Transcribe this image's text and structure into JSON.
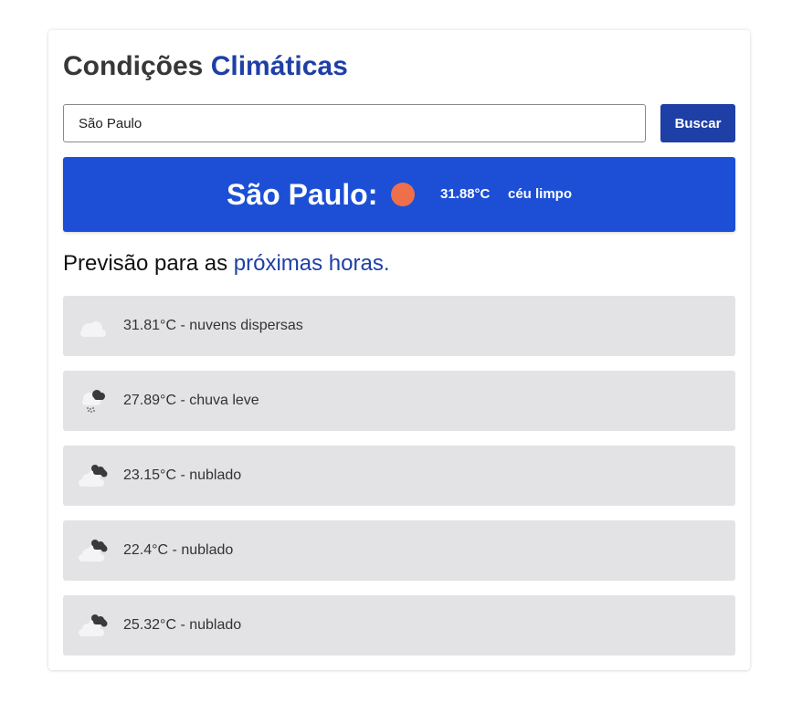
{
  "header": {
    "title_part1": "Condições",
    "title_part2": "Climáticas",
    "accent_color": "#1e3fa6"
  },
  "search": {
    "value": "São Paulo",
    "placeholder": "",
    "button_label": "Buscar"
  },
  "current": {
    "city_label": "São Paulo:",
    "icon": "sun-icon",
    "icon_color": "#ee6f4c",
    "temperature": "31.88°C",
    "description": "céu limpo",
    "background_color": "#1c4fd6"
  },
  "forecast": {
    "heading_part1": "Previsão para as",
    "heading_part2": "próximas horas.",
    "items": [
      {
        "icon": "scattered-clouds-icon",
        "text": "31.81°C - nuvens dispersas"
      },
      {
        "icon": "light-rain-icon",
        "text": "27.89°C - chuva leve"
      },
      {
        "icon": "overcast-clouds-icon",
        "text": "23.15°C - nublado"
      },
      {
        "icon": "overcast-clouds-icon",
        "text": "22.4°C - nublado"
      },
      {
        "icon": "overcast-clouds-icon",
        "text": "25.32°C - nublado"
      }
    ]
  }
}
